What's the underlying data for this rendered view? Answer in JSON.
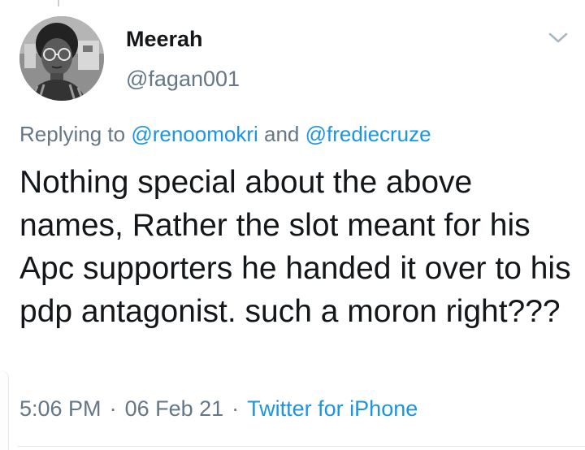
{
  "tweet": {
    "display_name": "Meerah",
    "handle": "@fagan001",
    "replying_prefix": "Replying to ",
    "replying_mention_1": "@renoomokri",
    "replying_conjunction": " and ",
    "replying_mention_2": "@frediecruze",
    "text": "Nothing special about the above names, Rather the slot meant for his Apc supporters he handed it over to his pdp antagonist. such a moron right???",
    "time": "5:06 PM",
    "separator": "·",
    "date": "06 Feb 21",
    "source": "Twitter for iPhone"
  },
  "colors": {
    "primary_text": "#14171a",
    "secondary_text": "#657786",
    "link": "#1b95e0",
    "divider": "#e1e8ed"
  },
  "icons": {
    "menu": "chevron-down-icon",
    "avatar": "profile-photo"
  }
}
